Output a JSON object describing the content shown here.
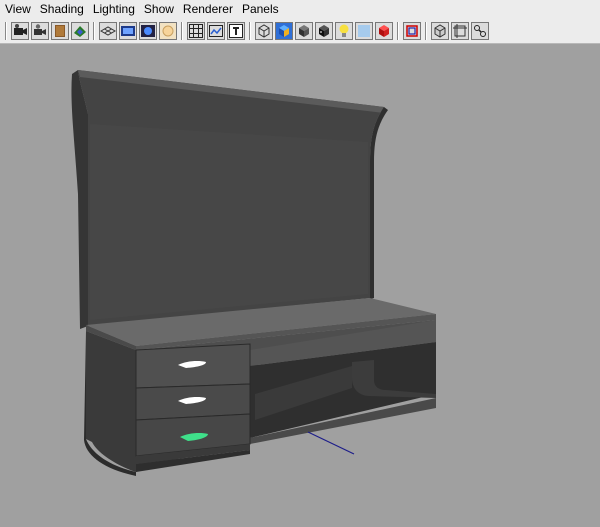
{
  "menubar": {
    "items": [
      "View",
      "Shading",
      "Lighting",
      "Show",
      "Renderer",
      "Panels"
    ]
  },
  "toolbar": {
    "groups": [
      [
        "camera-select-icon",
        "camera-attributes-icon",
        "bookmarks-icon",
        "image-plane-icon"
      ],
      [
        "grid-icon",
        "film-gate-icon",
        "resolution-gate-icon",
        "field-chart-icon"
      ],
      [
        "safe-action-icon",
        "safe-title-icon",
        "gate-mask-icon"
      ],
      [
        "wireframe-icon",
        "smooth-shade-icon",
        "flat-shade-icon",
        "textured-icon",
        "use-default-light-icon",
        "xray-icon",
        "shadows-icon"
      ],
      [
        "isolate-select-icon"
      ],
      [
        "xray-joints-icon",
        "xray-active-icon",
        "show-manipulators-icon"
      ]
    ]
  },
  "colors": {
    "background": "#a0a0a0",
    "menu_background": "#ececec",
    "model_dark": "#404040",
    "model_light": "#5a5a5a",
    "handle_white": "#ffffff",
    "handle_selected": "#3fe08a",
    "axis_line": "#1d1d8a"
  }
}
